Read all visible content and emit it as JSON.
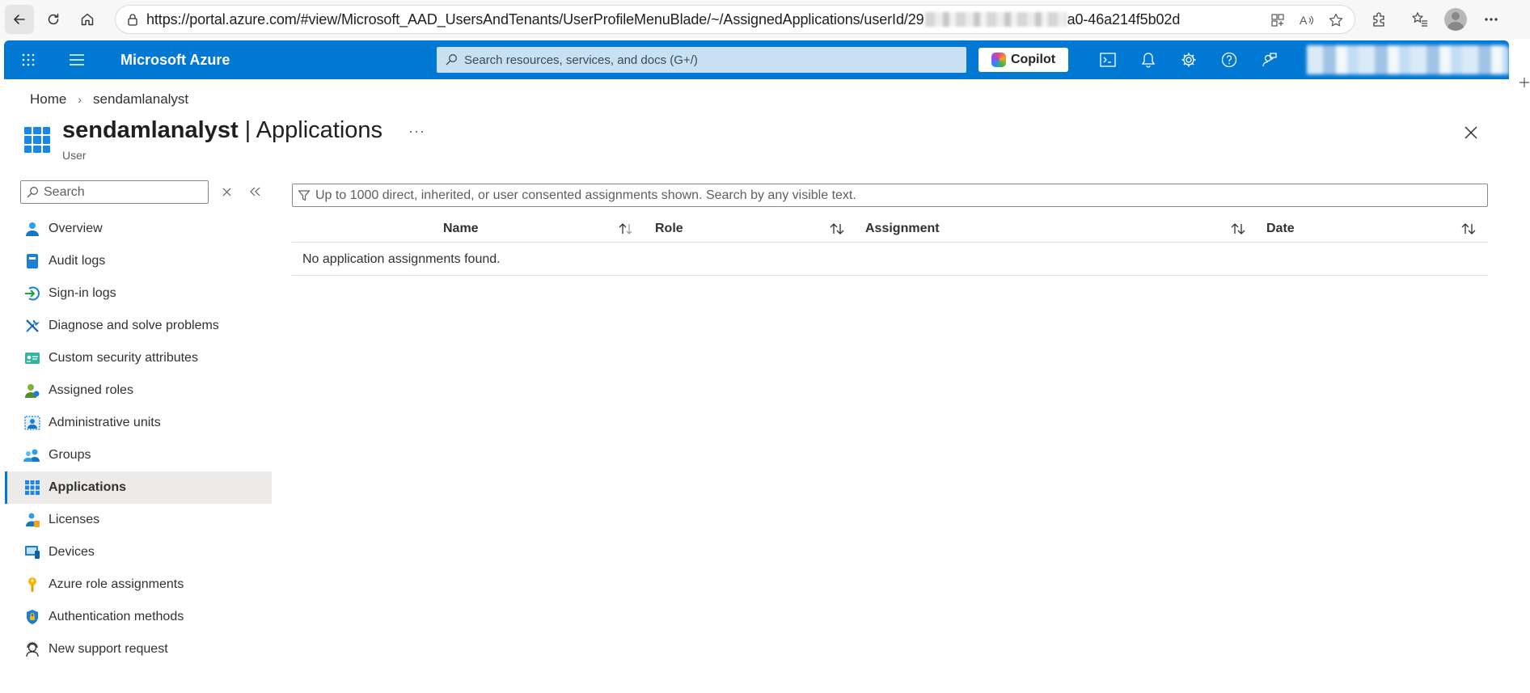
{
  "browser": {
    "url_prefix": "https://portal.azure.com/#view/Microsoft_AAD_UsersAndTenants/UserProfileMenuBlade/~/AssignedApplications/userId/29",
    "url_suffix": "a0-46a214f5b02d"
  },
  "header": {
    "brand": "Microsoft Azure",
    "search_placeholder": "Search resources, services, and docs (G+/)",
    "copilot_label": "Copilot"
  },
  "breadcrumb": {
    "home": "Home",
    "current": "sendamlanalyst"
  },
  "page": {
    "title_name": "sendamlanalyst",
    "title_separator": " | ",
    "title_section": "Applications",
    "subtitle": "User",
    "more": "···"
  },
  "nav": {
    "search_placeholder": "Search",
    "items": [
      {
        "label": "Overview",
        "icon": "user-icon"
      },
      {
        "label": "Audit logs",
        "icon": "audit-log-icon"
      },
      {
        "label": "Sign-in logs",
        "icon": "sign-in-icon"
      },
      {
        "label": "Diagnose and solve problems",
        "icon": "wrench-icon"
      },
      {
        "label": "Custom security attributes",
        "icon": "attributes-card-icon"
      },
      {
        "label": "Assigned roles",
        "icon": "assigned-roles-icon"
      },
      {
        "label": "Administrative units",
        "icon": "admin-units-icon"
      },
      {
        "label": "Groups",
        "icon": "groups-icon"
      },
      {
        "label": "Applications",
        "icon": "apps-grid-icon"
      },
      {
        "label": "Licenses",
        "icon": "licenses-icon"
      },
      {
        "label": "Devices",
        "icon": "devices-icon"
      },
      {
        "label": "Azure role assignments",
        "icon": "key-icon"
      },
      {
        "label": "Authentication methods",
        "icon": "shield-icon"
      },
      {
        "label": "New support request",
        "icon": "support-person-icon"
      }
    ],
    "selected": "Applications"
  },
  "main": {
    "filter_placeholder": "Up to 1000 direct, inherited, or user consented assignments shown. Search by any visible text.",
    "columns": [
      "Name",
      "Role",
      "Assignment",
      "Date"
    ],
    "empty_message": "No application assignments found."
  },
  "colors": {
    "azure_blue": "#0078d4",
    "search_bg": "#c7e0f4",
    "selected_bg": "#edebe9"
  }
}
